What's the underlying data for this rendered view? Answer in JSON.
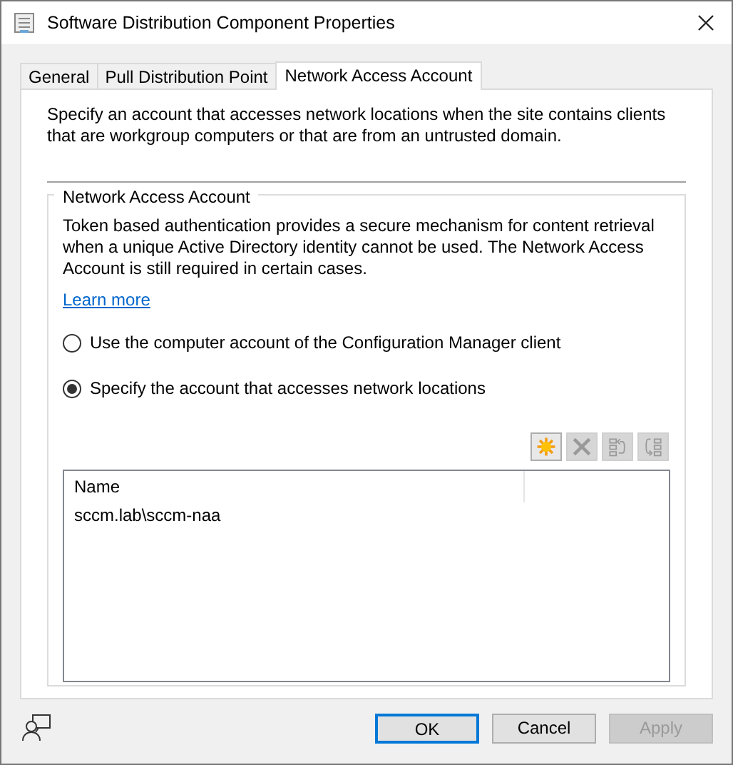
{
  "window": {
    "title": "Software Distribution Component Properties"
  },
  "tabs": [
    {
      "label": "General",
      "selected": false
    },
    {
      "label": "Pull Distribution Point",
      "selected": false
    },
    {
      "label": "Network Access Account",
      "selected": true
    }
  ],
  "intro": "Specify an account that accesses network locations when the site contains clients that are workgroup computers or that are from an untrusted domain.",
  "group": {
    "title": "Network Access Account",
    "description": "Token based authentication provides a secure mechanism for content retrieval when a unique Active Directory identity cannot be used. The Network Access Account is still required in certain cases.",
    "link": "Learn more",
    "options": [
      {
        "label": "Use the computer account of the Configuration Manager client",
        "selected": false
      },
      {
        "label": "Specify the account that accesses network locations",
        "selected": true
      }
    ],
    "toolbar": [
      {
        "kind": "new",
        "disabled": false
      },
      {
        "kind": "delete",
        "disabled": true
      },
      {
        "kind": "up",
        "disabled": true
      },
      {
        "kind": "down",
        "disabled": true
      }
    ],
    "table": {
      "columns": [
        "Name"
      ],
      "rows": [
        [
          "sccm.lab\\sccm-naa"
        ]
      ]
    }
  },
  "buttons": [
    {
      "label": "OK",
      "default": true,
      "disabled": false
    },
    {
      "label": "Cancel",
      "default": false,
      "disabled": false
    },
    {
      "label": "Apply",
      "default": false,
      "disabled": true
    }
  ]
}
